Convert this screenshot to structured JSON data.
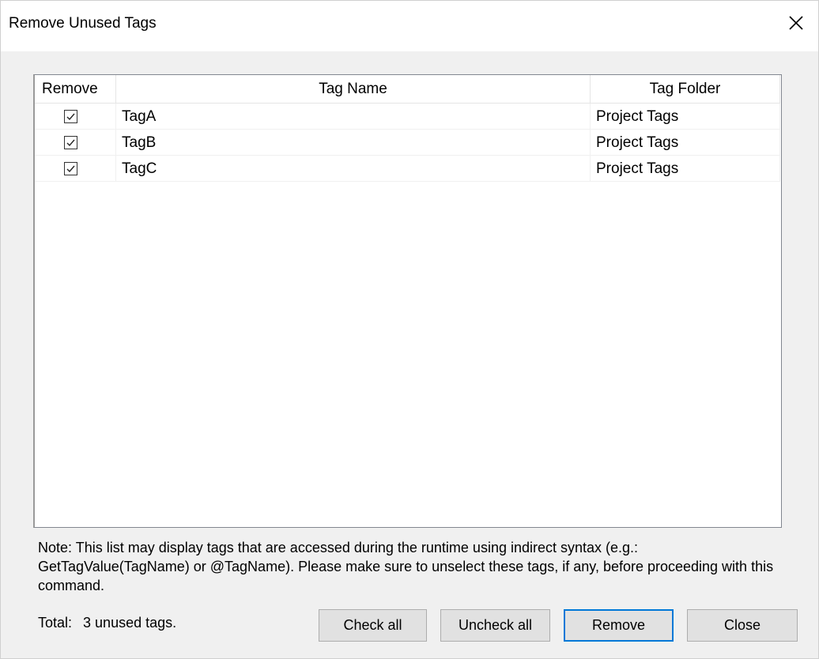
{
  "window": {
    "title": "Remove Unused Tags",
    "close_icon": "close-icon"
  },
  "table": {
    "columns": [
      "Remove",
      "Tag Name",
      "Tag Folder"
    ],
    "rows": [
      {
        "checked": true,
        "name": "TagA",
        "folder": "Project Tags"
      },
      {
        "checked": true,
        "name": "TagB",
        "folder": "Project Tags"
      },
      {
        "checked": true,
        "name": "TagC",
        "folder": "Project Tags"
      }
    ]
  },
  "note": "Note: This list may display tags that are accessed during the runtime using indirect syntax (e.g.: GetTagValue(TagName) or @TagName). Please make sure to unselect these tags, if any, before proceeding with this command.",
  "footer": {
    "total_label": "Total:",
    "total_value": "3 unused tags."
  },
  "buttons": {
    "check_all": "Check all",
    "uncheck_all": "Uncheck all",
    "remove": "Remove",
    "close": "Close"
  },
  "colors": {
    "accent": "#0078d7",
    "dialog_bg": "#f0f0f0"
  }
}
